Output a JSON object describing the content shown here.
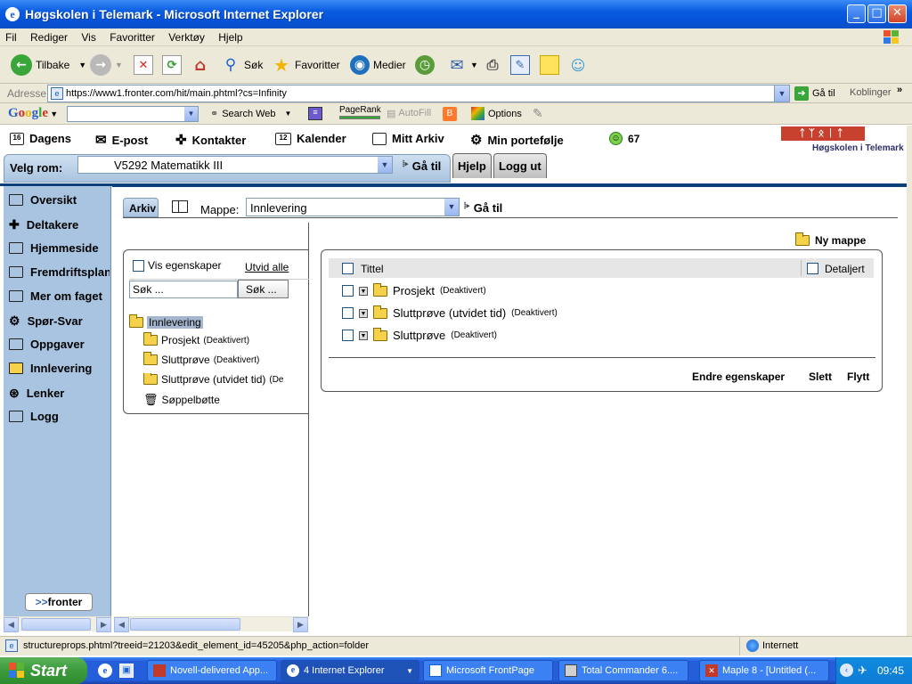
{
  "window": {
    "title": "Høgskolen i Telemark - Microsoft Internet Explorer"
  },
  "menu": [
    "Fil",
    "Rediger",
    "Vis",
    "Favoritter",
    "Verktøy",
    "Hjelp"
  ],
  "toolbar": {
    "back": "Tilbake",
    "search": "Søk",
    "favorites": "Favoritter",
    "media": "Medier"
  },
  "address": {
    "label": "Adresse",
    "url": "https://www1.fronter.com/hit/main.phtml?cs=Infinity",
    "go": "Gå til",
    "links": "Koblinger"
  },
  "google": {
    "search_web": "Search Web",
    "pagerank": "PageRank",
    "autofill": "AutoFill",
    "options": "Options"
  },
  "fronter_nav": {
    "today": "Dagens",
    "email": "E-post",
    "contacts": "Kontakter",
    "calendar": "Kalender",
    "archive": "Mitt Arkiv",
    "portfolio": "Min portefølje",
    "online": "67"
  },
  "brand": "Høgskolen i Telemark",
  "room": {
    "label": "Velg rom:",
    "value": "V5292 Matematikk III",
    "go": "Gå til",
    "help": "Hjelp",
    "logout": "Logg ut"
  },
  "sidebar": {
    "items": [
      "Oversikt",
      "Deltakere",
      "Hjemmeside",
      "Fremdriftsplan",
      "Mer om faget",
      "Spør-Svar",
      "Oppgaver",
      "Innlevering",
      "Lenker",
      "Logg"
    ],
    "logo": "fronter"
  },
  "archive": {
    "tab": "Arkiv",
    "folder_label": "Mappe:",
    "folder_value": "Innlevering",
    "go": "Gå til",
    "show_properties": "Vis egenskaper",
    "expand_all": "Utvid alle",
    "search_placeholder": "Søk ...",
    "search_button": "Søk ...",
    "tree": {
      "root": "Innlevering",
      "children": [
        {
          "name": "Prosjekt",
          "status": "(Deaktivert)"
        },
        {
          "name": "Sluttprøve",
          "status": "(Deaktivert)"
        },
        {
          "name": "Sluttprøve (utvidet tid)",
          "status": "(De"
        },
        {
          "name": "Søppelbøtte",
          "status": ""
        }
      ]
    },
    "new_folder": "Ny mappe",
    "list_header": {
      "title": "Tittel",
      "detailed": "Detaljert"
    },
    "rows": [
      {
        "name": "Prosjekt",
        "status": "(Deaktivert)"
      },
      {
        "name": "Sluttprøve (utvidet tid)",
        "status": "(Deaktivert)"
      },
      {
        "name": "Sluttprøve",
        "status": "(Deaktivert)"
      }
    ],
    "actions": {
      "edit": "Endre egenskaper",
      "delete": "Slett",
      "move": "Flytt"
    }
  },
  "status": {
    "text": "structureprops.phtml?treeid=21203&edit_element_id=45205&php_action=folder",
    "zone": "Internett"
  },
  "taskbar": {
    "start": "Start",
    "tasks": [
      "Novell-delivered App...",
      "4 Internet Explorer",
      "Microsoft FrontPage",
      "Total Commander 6....",
      "Maple 8 - [Untitled (..."
    ],
    "time": "09:45"
  }
}
